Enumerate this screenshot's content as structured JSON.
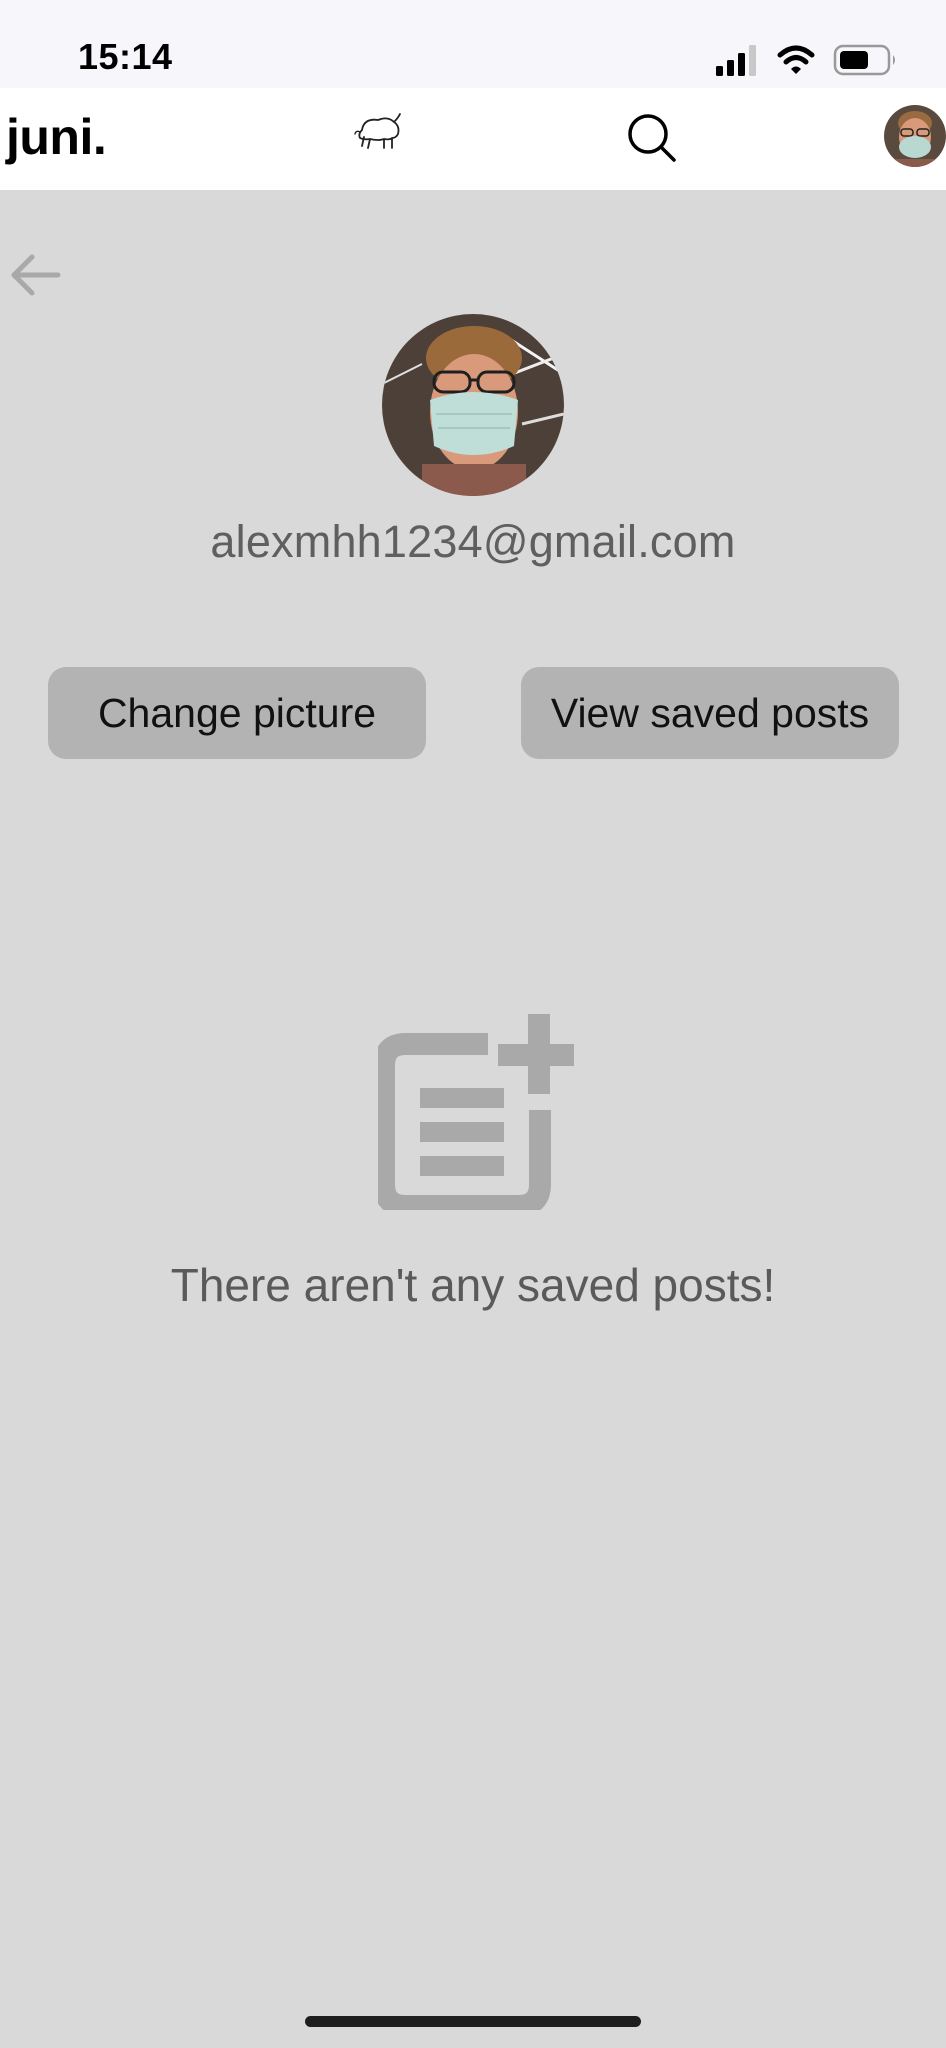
{
  "status_bar": {
    "time": "15:14",
    "icons": [
      "cellular-signal-icon",
      "wifi-icon",
      "battery-icon"
    ]
  },
  "nav": {
    "brand": "juni.",
    "logo_icon": "bison-logo-icon",
    "search_icon": "search-icon",
    "avatar_icon": "user-avatar"
  },
  "profile": {
    "email": "alexmhh1234@gmail.com",
    "change_picture_label": "Change picture",
    "view_saved_label": "View saved posts"
  },
  "empty_state": {
    "icon": "add-post-icon",
    "message": "There aren't any saved posts!"
  },
  "colors": {
    "background": "#d9d9d9",
    "nav_background": "#ffffff",
    "button_background": "#b3b3b3",
    "muted_text": "#5f5f5f",
    "icon_gray": "#a9a9a9"
  }
}
